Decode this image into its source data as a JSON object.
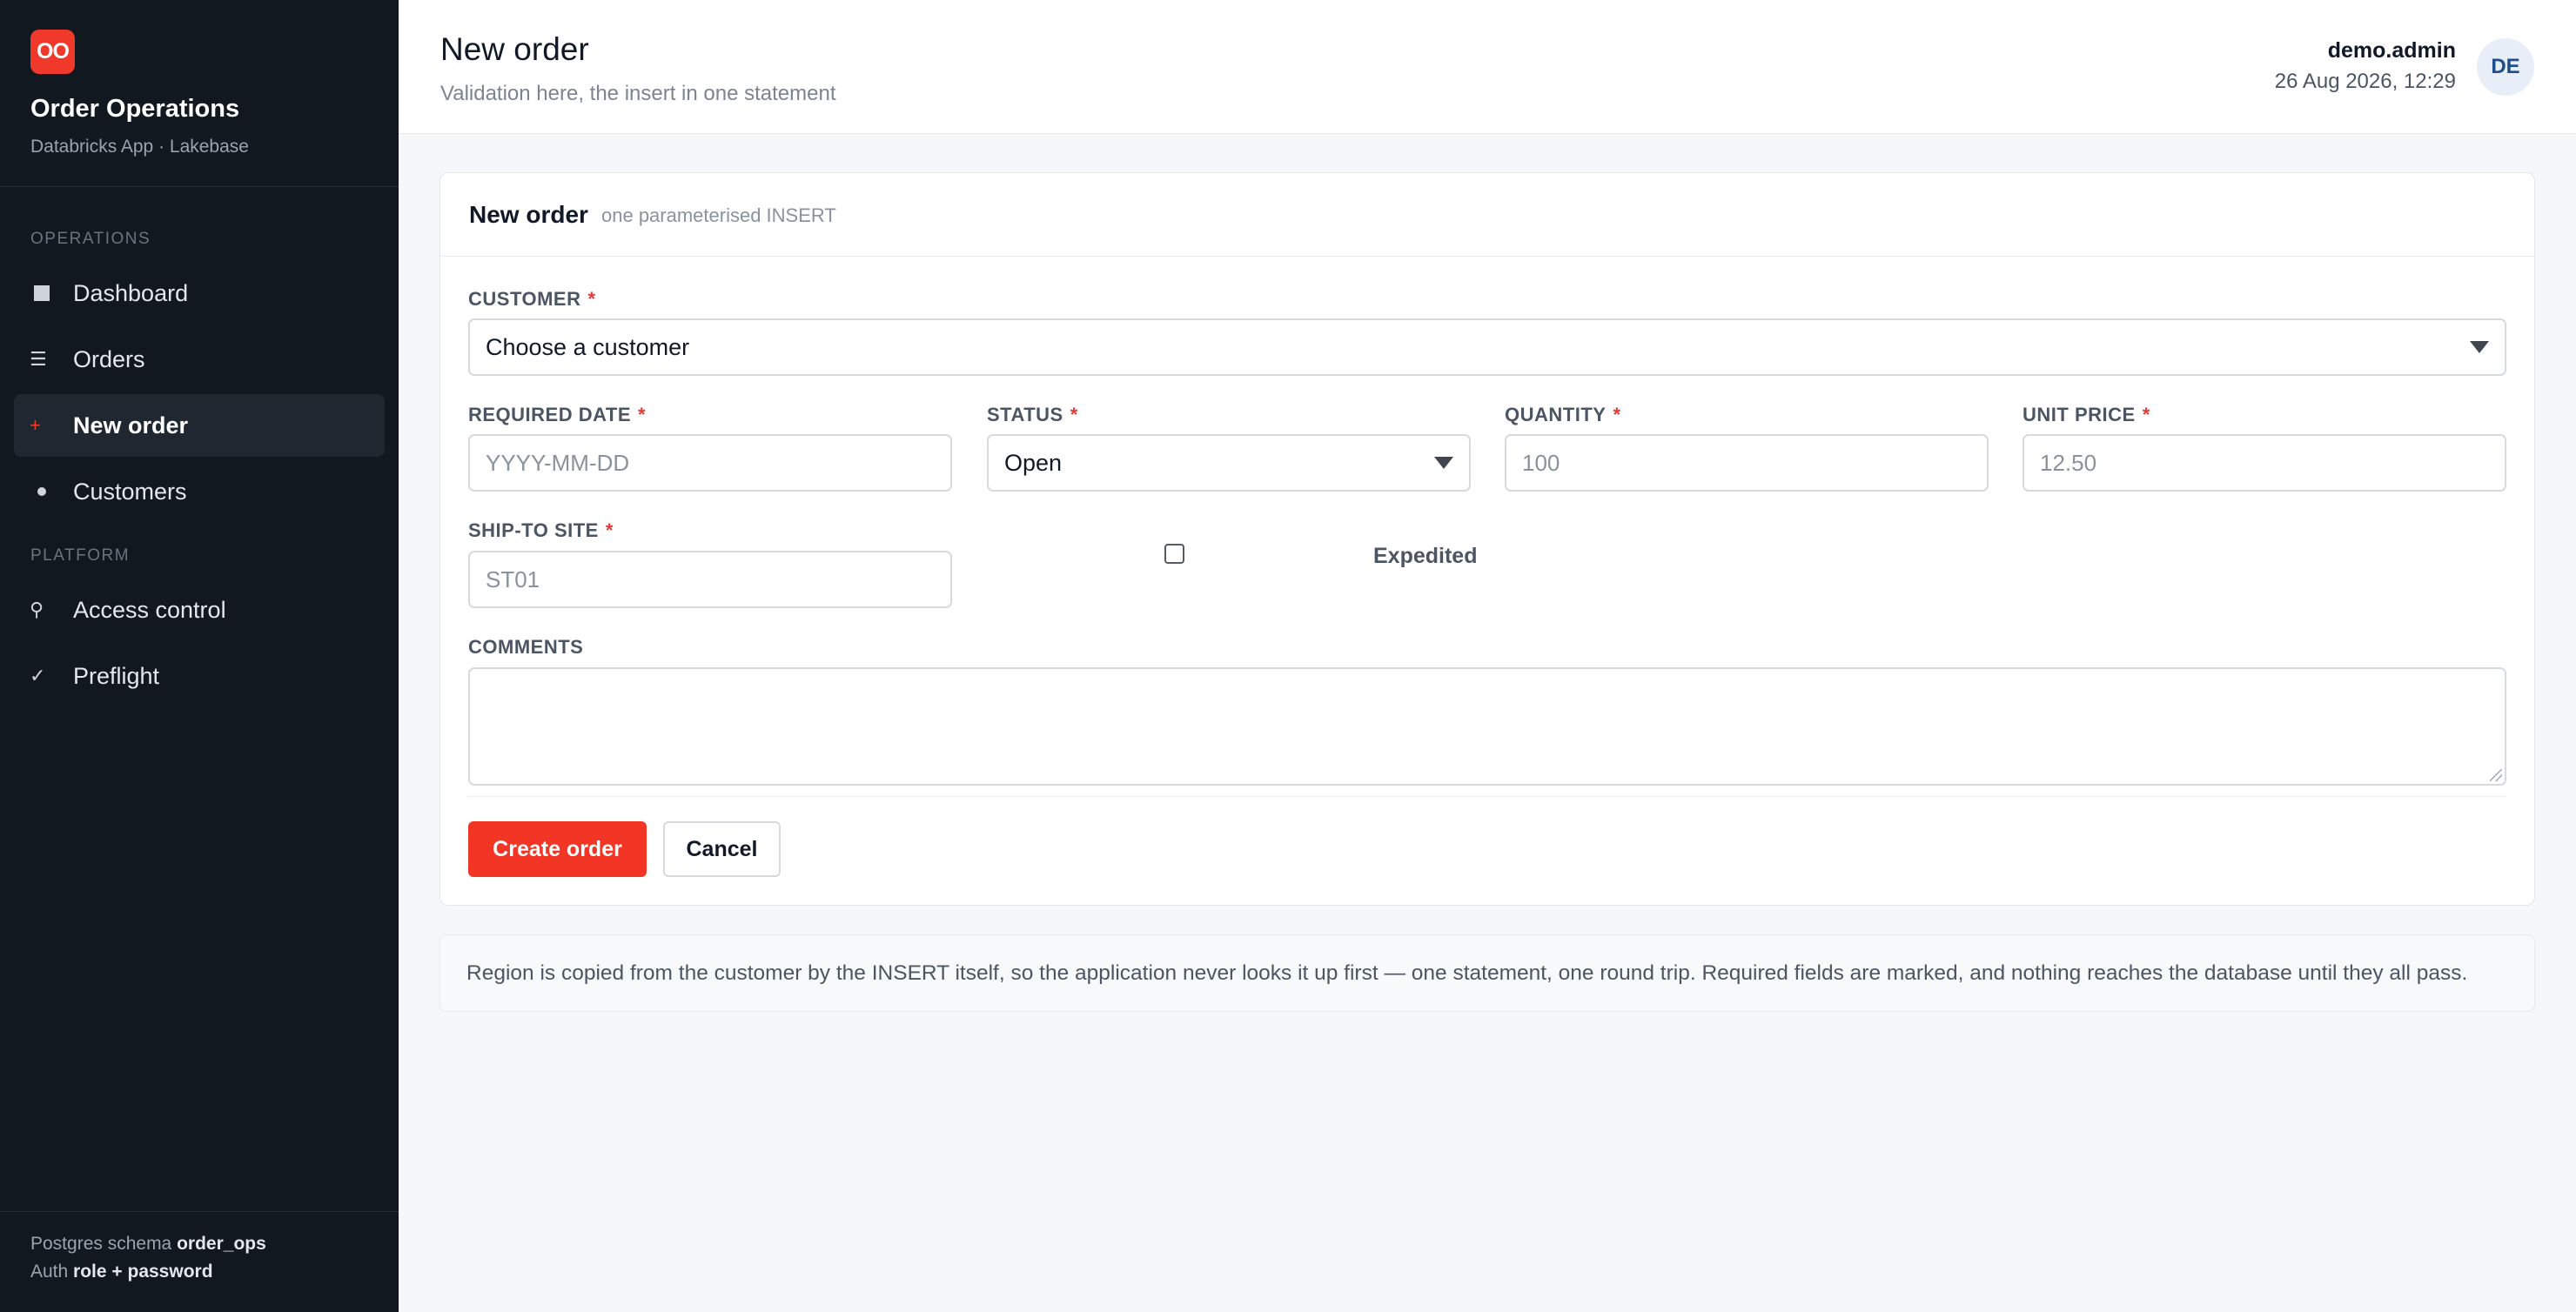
{
  "sidebar": {
    "logo_text": "OO",
    "app_title": "Order Operations",
    "app_subtitle": "Databricks App · Lakebase",
    "sections": [
      {
        "label": "OPERATIONS",
        "items": [
          {
            "label": "Dashboard",
            "icon": "square-icon",
            "active": false
          },
          {
            "label": "Orders",
            "icon": "list-icon",
            "active": false
          },
          {
            "label": "New order",
            "icon": "plus-icon",
            "active": true
          },
          {
            "label": "Customers",
            "icon": "dot-icon",
            "active": false
          }
        ]
      },
      {
        "label": "PLATFORM",
        "items": [
          {
            "label": "Access control",
            "icon": "key-icon",
            "active": false
          },
          {
            "label": "Preflight",
            "icon": "check-icon",
            "active": false
          }
        ]
      }
    ],
    "footer": {
      "schema_prefix": "Postgres schema",
      "schema_value": "order_ops",
      "auth_prefix": "Auth",
      "auth_value": "role + password"
    }
  },
  "header": {
    "title": "New order",
    "subtitle": "Validation here, the insert in one statement",
    "user_name": "demo.admin",
    "timestamp": "26 Aug 2026, 12:29",
    "avatar_initials": "DE"
  },
  "card": {
    "title": "New order",
    "note": "one parameterised INSERT",
    "required_marker": "*",
    "fields": {
      "customer": {
        "label": "CUSTOMER",
        "value": "Choose a customer"
      },
      "required_date": {
        "label": "REQUIRED DATE",
        "placeholder": "YYYY-MM-DD",
        "value": ""
      },
      "status": {
        "label": "STATUS",
        "value": "Open"
      },
      "quantity": {
        "label": "QUANTITY",
        "placeholder": "100",
        "value": ""
      },
      "unit_price": {
        "label": "UNIT PRICE",
        "placeholder": "12.50",
        "value": ""
      },
      "ship_to_site": {
        "label": "SHIP-TO SITE",
        "placeholder": "ST01",
        "value": ""
      },
      "expedited": {
        "label": "Expedited",
        "checked": false
      },
      "comments": {
        "label": "COMMENTS",
        "value": ""
      }
    },
    "buttons": {
      "create": "Create order",
      "cancel": "Cancel"
    }
  },
  "info_note": "Region is copied from the customer by the INSERT itself, so the application never looks it up first — one statement, one round trip. Required fields are marked, and nothing reaches the database until they all pass.",
  "colors": {
    "accent": "#f23524",
    "sidebar_bg": "#111820",
    "avatar_bg": "#e7eef8"
  }
}
